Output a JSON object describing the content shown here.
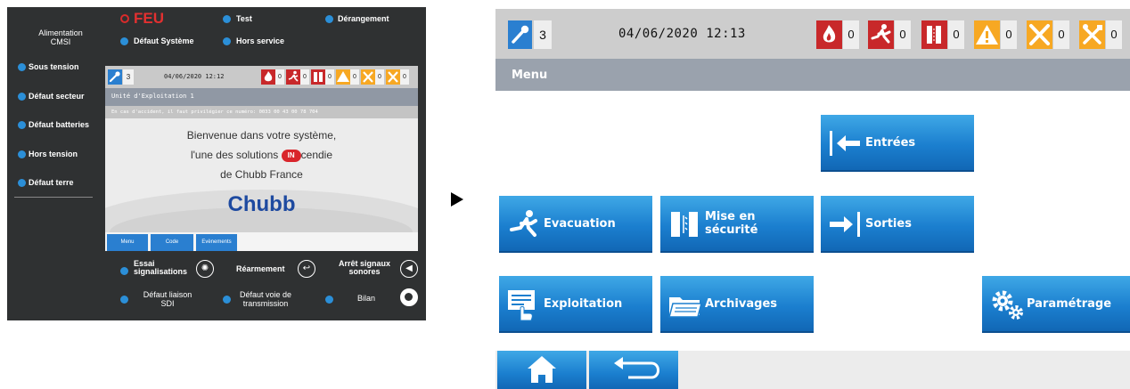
{
  "left_panel": {
    "header": {
      "alimentation": "Alimentation\nCMSI",
      "feu": "FEU",
      "test": "Test",
      "derangement": "Dérangement",
      "defaut_systeme": "Défaut Système",
      "hors_service": "Hors service"
    },
    "side_items": [
      "Sous tension",
      "Défaut secteur",
      "Défaut batteries",
      "Hors tension",
      "Défaut terre"
    ],
    "screen": {
      "key_count": "3",
      "datetime": "04/06/2020 12:12",
      "counters": [
        "0",
        "0",
        "0",
        "0",
        "0",
        "0"
      ],
      "subtitle": "Unité d'Exploitation 1",
      "note": "En cas d'accident, il faut privilégier ce numéro: 0033 00 43 00 78 704",
      "welcome_line1": "Bienvenue dans votre système,",
      "welcome_line2_pre": "l'une des solutions ",
      "welcome_badge": "IN",
      "welcome_line2_post": "cendie",
      "welcome_line3": "de Chubb France",
      "logo": "Chubb",
      "nav": [
        "Menu",
        "Code",
        "Evènements"
      ]
    },
    "bottom": {
      "essai": "Essai\nsignalisations",
      "rearmement": "Réarmement",
      "arret": "Arrêt signaux\nsonores",
      "liaison": "Défaut liaison\nSDI",
      "voie": "Défaut voie de\ntransmission",
      "bilan": "Bilan"
    }
  },
  "main_screen": {
    "key_count": "3",
    "datetime": "04/06/2020 12:13",
    "counters": [
      "0",
      "0",
      "0",
      "0",
      "0",
      "0"
    ],
    "menu_title": "Menu",
    "tiles": {
      "entrees": "Entrées",
      "evacuation": "Evacuation",
      "mise_en_securite": "Mise en\nsécurité",
      "sorties": "Sorties",
      "exploitation": "Exploitation",
      "archivages": "Archivages",
      "parametrage": "Paramétrage"
    }
  },
  "colors": {
    "accent_blue": "#1b7fcf",
    "fire_red": "#c8282a",
    "warning_yellow": "#f7a823",
    "panel_dark": "#2f3132"
  }
}
